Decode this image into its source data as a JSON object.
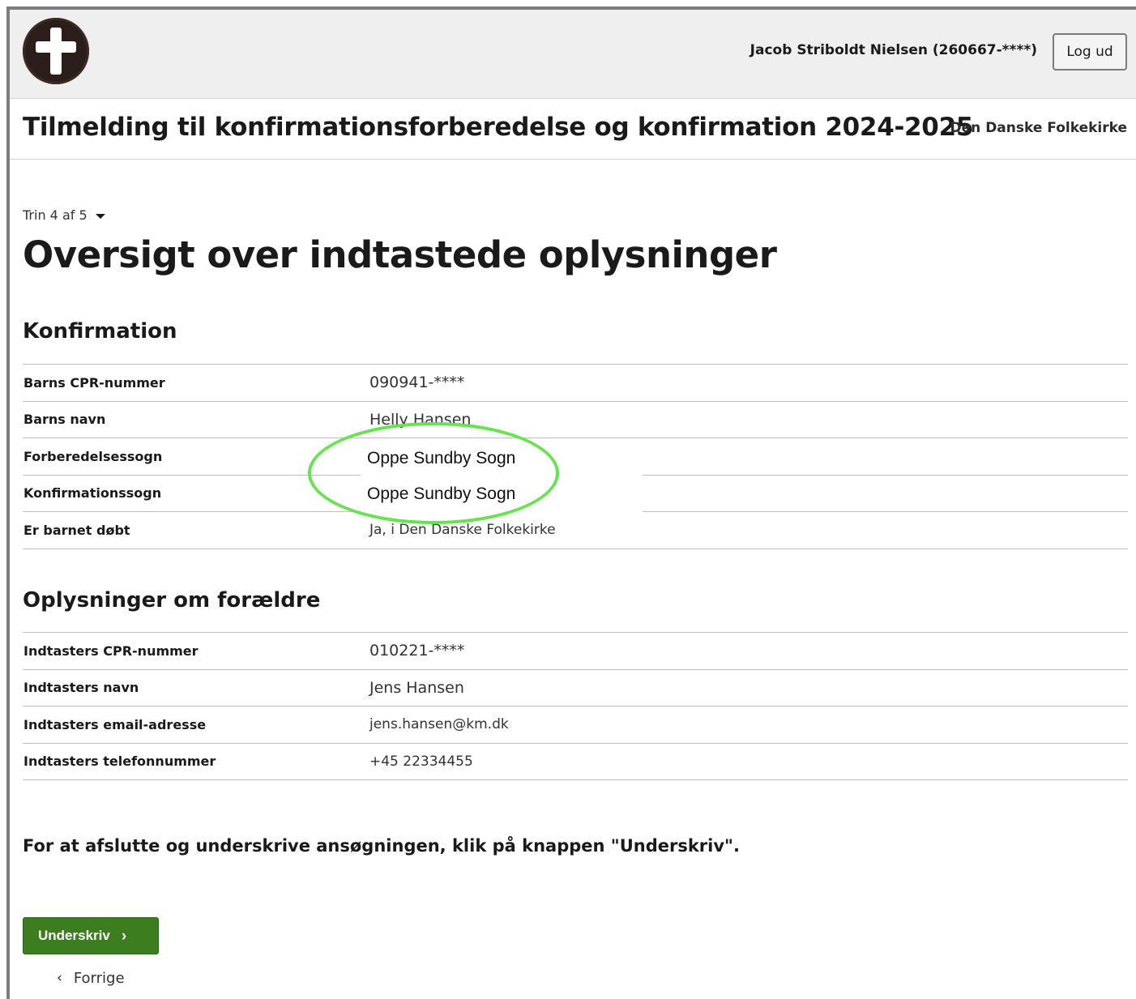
{
  "header": {
    "user": "Jacob Striboldt Nielsen (260667-****)",
    "logout_label": "Log ud"
  },
  "titlebar": {
    "title": "Tilmelding til konfirmationsforberedelse og konfirmation 2024-2025",
    "org": "Den Danske Folkekirke"
  },
  "step": {
    "label": "Trin 4 af 5"
  },
  "page_title": "Oversigt over indtastede oplysninger",
  "confirmation": {
    "title": "Konfirmation",
    "rows": [
      {
        "label": "Barns CPR-nummer",
        "value": "090941-****"
      },
      {
        "label": "Barns navn",
        "value": "Helly Hansen"
      },
      {
        "label": "Forberedelsessogn",
        "value": ""
      },
      {
        "label": "Konfirmationssogn",
        "value": ""
      },
      {
        "label": "Er barnet døbt",
        "value": "Ja, i Den Danske Folkekirke"
      }
    ],
    "overlay_prep_parish": "Oppe Sundby Sogn",
    "overlay_conf_parish": "Oppe Sundby Sogn"
  },
  "parents": {
    "title": "Oplysninger om forældre",
    "rows": [
      {
        "label": "Indtasters CPR-nummer",
        "value": "010221-****"
      },
      {
        "label": "Indtasters navn",
        "value": "Jens Hansen"
      },
      {
        "label": "Indtasters email-adresse",
        "value": "jens.hansen@km.dk"
      },
      {
        "label": "Indtasters telefonnummer",
        "value": "+45 22334455"
      }
    ]
  },
  "instruction": "For at afslutte og underskrive ansøgningen, klik på knappen \"Underskriv\".",
  "actions": {
    "sign_label": "Underskriv",
    "back_label": "Forrige"
  },
  "colors": {
    "primary_button": "#3b7d1f",
    "highlight_circle": "#66e34f",
    "header_bg": "#efefef"
  },
  "icons": {
    "logo": "cross-logo-icon",
    "step_toggle": "caret-down-icon",
    "sign": "chevron-right-icon",
    "back": "chevron-left-icon"
  }
}
